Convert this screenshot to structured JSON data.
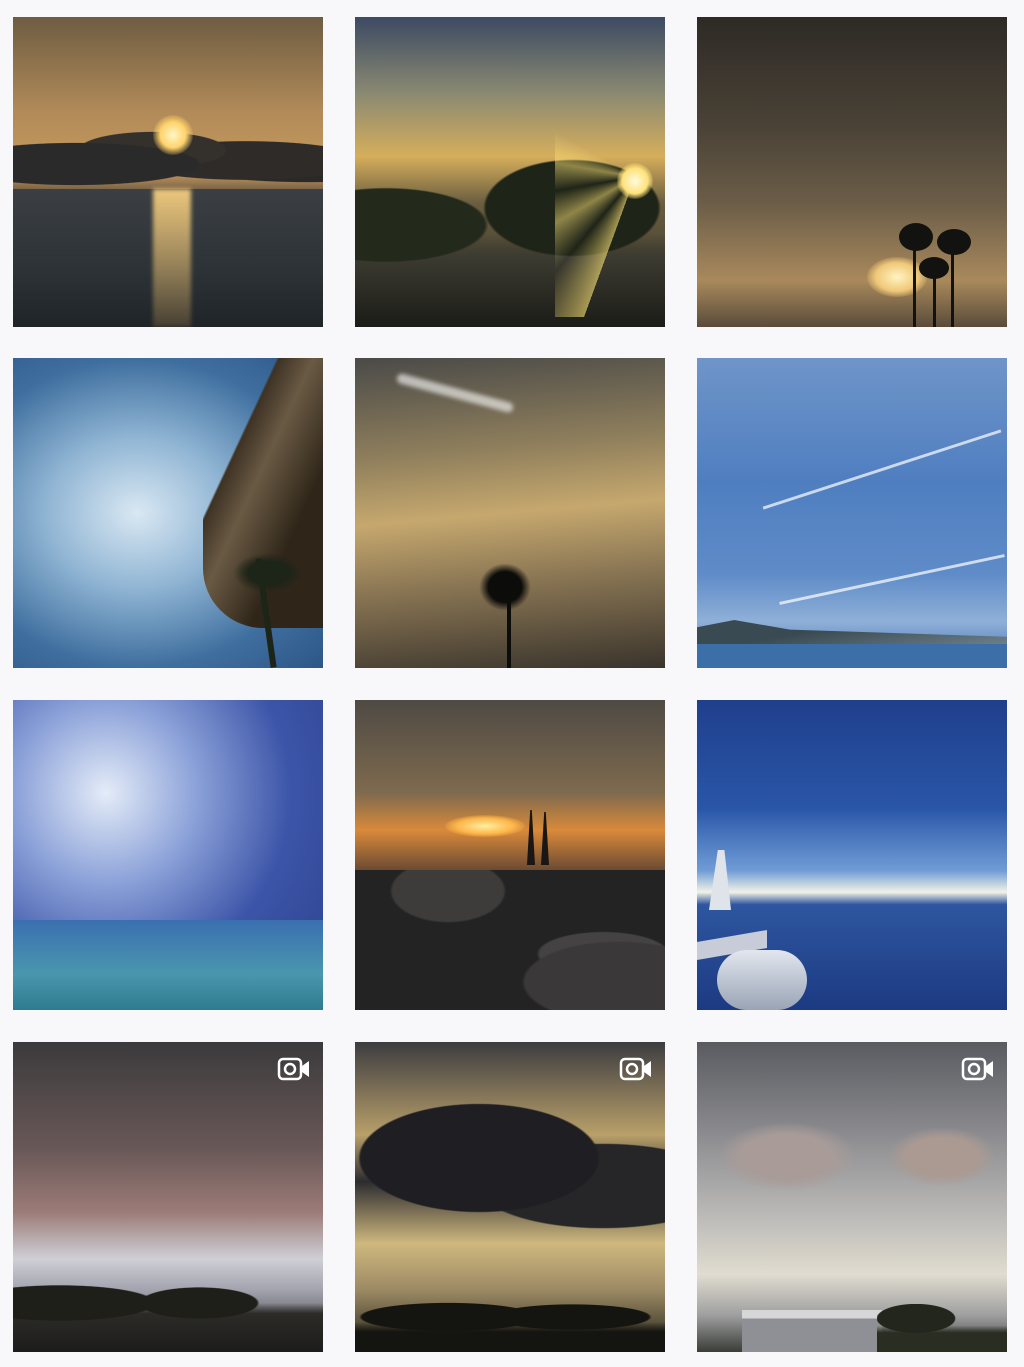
{
  "gallery": {
    "posts": [
      {
        "name": "post-ocean-sunset",
        "video": false
      },
      {
        "name": "post-sunburst-trees",
        "video": false
      },
      {
        "name": "post-palm-silhouettes-dusk",
        "video": false
      },
      {
        "name": "post-blue-sky-palm-thatch",
        "video": false
      },
      {
        "name": "post-golden-sky-palm",
        "video": false
      },
      {
        "name": "post-blue-sky-contrails",
        "video": false
      },
      {
        "name": "post-blue-storm-clouds",
        "video": false
      },
      {
        "name": "post-sunset-parking-lot",
        "video": false
      },
      {
        "name": "post-airplane-wing-horizon",
        "video": false
      },
      {
        "name": "post-evening-clouds-city",
        "video": true
      },
      {
        "name": "post-storm-clouds-golden",
        "video": true
      },
      {
        "name": "post-pale-sky-building",
        "video": true
      }
    ],
    "video_icon": "video-camera-icon",
    "colors": {
      "background": "#f8f8fb",
      "video_icon": "#ffffff"
    }
  }
}
